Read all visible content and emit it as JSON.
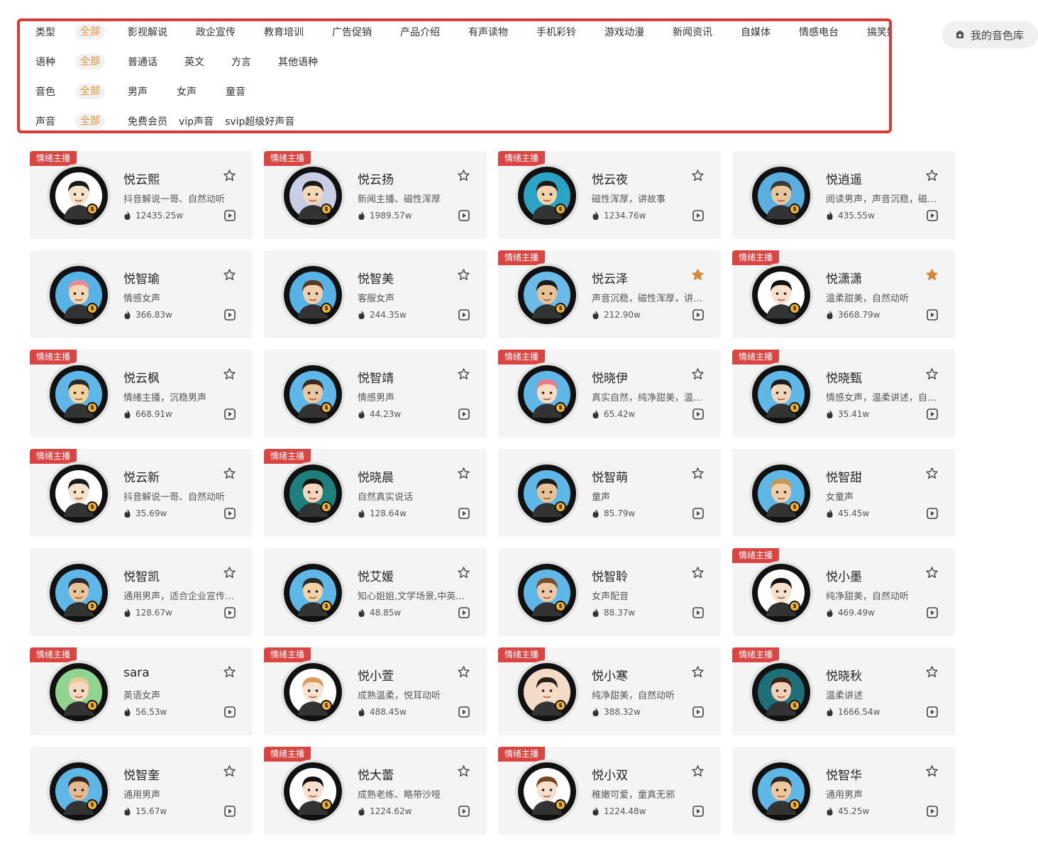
{
  "filters": {
    "type": {
      "label": "类型",
      "all": "全部",
      "options": [
        "影视解说",
        "政企宣传",
        "教育培训",
        "广告促销",
        "产品介绍",
        "有声读物",
        "手机彩铃",
        "游戏动漫",
        "新闻资讯",
        "自媒体",
        "情感电台",
        "搞笑娱乐"
      ]
    },
    "lang": {
      "label": "语种",
      "all": "全部",
      "options": [
        "普通话",
        "英文",
        "方言",
        "其他语种"
      ]
    },
    "timbre": {
      "label": "音色",
      "all": "全部",
      "options": [
        "男声",
        "女声",
        "童音"
      ]
    },
    "voice": {
      "label": "声音",
      "all": "全部",
      "options": [
        "免费会员",
        "vip声音",
        "svip超级好声音"
      ]
    }
  },
  "library_button": "我的音色库",
  "badge_text": "情绪主播",
  "coin_text": "$",
  "colors": {
    "accent": "#e0953b",
    "badge": "#d94542",
    "frame": "#d93a35",
    "star_active": "#d4883a"
  },
  "cards": [
    {
      "name": "悦云熙",
      "desc": "抖音解说一哥、自然动听",
      "plays": "12435.25w",
      "badge": true,
      "fav": false,
      "skin": "#f6e2c8",
      "hair": "#1a1a1a",
      "bg": "#ffffff"
    },
    {
      "name": "悦云扬",
      "desc": "新闻主播、磁性浑厚",
      "plays": "1989.57w",
      "badge": true,
      "fav": false,
      "skin": "#f3d8b8",
      "hair": "#1a1a1a",
      "bg": "#c9cde6"
    },
    {
      "name": "悦云夜",
      "desc": "磁性浑厚，讲故事",
      "plays": "1234.76w",
      "badge": true,
      "fav": false,
      "skin": "#f1d2a8",
      "hair": "#1a1a1a",
      "bg": "#2ba3c4"
    },
    {
      "name": "悦逍遥",
      "desc": "阅读男声，声音沉稳，磁性浑厚",
      "plays": "435.55w",
      "badge": false,
      "fav": false,
      "skin": "#e8c69c",
      "hair": "#3a3a3a",
      "bg": "#5aaee0"
    },
    {
      "name": "悦智瑜",
      "desc": "情感女声",
      "plays": "366.83w",
      "badge": false,
      "fav": false,
      "skin": "#f1d7b6",
      "hair": "#e98a9b",
      "bg": "#57b3e6"
    },
    {
      "name": "悦智美",
      "desc": "客服女声",
      "plays": "244.35w",
      "badge": false,
      "fav": false,
      "skin": "#f0cfae",
      "hair": "#5b3a24",
      "bg": "#57b3e6"
    },
    {
      "name": "悦云泽",
      "desc": "声音沉稳，磁性浑厚，讲故事",
      "plays": "212.90w",
      "badge": true,
      "fav": true,
      "skin": "#e8c197",
      "hair": "#1a1a1a",
      "bg": "#6bbbe8"
    },
    {
      "name": "悦潇潇",
      "desc": "温柔甜美，自然动听",
      "plays": "3668.79w",
      "badge": true,
      "fav": true,
      "skin": "#f7e0cd",
      "hair": "#111111",
      "bg": "#ffffff"
    },
    {
      "name": "悦云枫",
      "desc": "情绪主播，沉稳男声",
      "plays": "668.91w",
      "badge": true,
      "fav": false,
      "skin": "#f2d3a0",
      "hair": "#2a2a2a",
      "bg": "#5fb7e8"
    },
    {
      "name": "悦智靖",
      "desc": "情感男声",
      "plays": "44.23w",
      "badge": false,
      "fav": false,
      "skin": "#e9c7a0",
      "hair": "#3a2a1e",
      "bg": "#5fb7e8"
    },
    {
      "name": "悦晓伊",
      "desc": "真实自然，纯净甜美，温柔讲述",
      "plays": "65.42w",
      "badge": true,
      "fav": false,
      "skin": "#f6dcc3",
      "hair": "#f07a8c",
      "bg": "#5fb7e8"
    },
    {
      "name": "悦晓甄",
      "desc": "情感女声，温柔讲述，自然动听",
      "plays": "35.41w",
      "badge": true,
      "fav": false,
      "skin": "#f2d6bb",
      "hair": "#1c1c1c",
      "bg": "#5fb7e8"
    },
    {
      "name": "悦云新",
      "desc": "抖音解说一哥、自然动听",
      "plays": "35.69w",
      "badge": true,
      "fav": false,
      "skin": "#f6e2c8",
      "hair": "#1a1a1a",
      "bg": "#ffffff"
    },
    {
      "name": "悦晓晨",
      "desc": "自然真实说话",
      "plays": "128.64w",
      "badge": true,
      "fav": false,
      "skin": "#f3d6bd",
      "hair": "#111111",
      "bg": "#1f7f7d"
    },
    {
      "name": "悦智萌",
      "desc": "童声",
      "plays": "85.79w",
      "badge": false,
      "fav": false,
      "skin": "#e8c197",
      "hair": "#1a1a1a",
      "bg": "#5fb7e8"
    },
    {
      "name": "悦智甜",
      "desc": "女童声",
      "plays": "45.45w",
      "badge": false,
      "fav": false,
      "skin": "#efcfa9",
      "hair": "#c9964a",
      "bg": "#5fb7e8"
    },
    {
      "name": "悦智凯",
      "desc": "通用男声，适合企业宣传片配音",
      "plays": "128.67w",
      "badge": false,
      "fav": false,
      "skin": "#e9c39a",
      "hair": "#2a2a2a",
      "bg": "#5fb7e8"
    },
    {
      "name": "悦艾媛",
      "desc": "知心姐姐,文学场景,中英文混合",
      "plays": "48.85w",
      "badge": false,
      "fav": false,
      "skin": "#f2d3a8",
      "hair": "#2a2a2a",
      "bg": "#5fb7e8"
    },
    {
      "name": "悦智聆",
      "desc": "女声配音",
      "plays": "88.37w",
      "badge": false,
      "fav": false,
      "skin": "#ecc9a4",
      "hair": "#7a4a2a",
      "bg": "#5fb7e8"
    },
    {
      "name": "悦小墨",
      "desc": "纯净甜美，自然动听",
      "plays": "469.49w",
      "badge": true,
      "fav": false,
      "skin": "#f6dfcc",
      "hair": "#111111",
      "bg": "#ffffff"
    },
    {
      "name": "sara",
      "desc": "英语女声",
      "plays": "56.53w",
      "badge": true,
      "fav": false,
      "skin": "#f6d7c0",
      "hair": "#e9c995",
      "bg": "#8fd58f"
    },
    {
      "name": "悦小萱",
      "desc": "成熟温柔，悦耳动听",
      "plays": "488.45w",
      "badge": true,
      "fav": false,
      "skin": "#f7e2d0",
      "hair": "#d99a5a",
      "bg": "#ffffff"
    },
    {
      "name": "悦小寒",
      "desc": "纯净甜美，自然动听",
      "plays": "388.32w",
      "badge": true,
      "fav": false,
      "skin": "#f5dcc8",
      "hair": "#2a1e1a",
      "bg": "#f2dcc8"
    },
    {
      "name": "悦晓秋",
      "desc": "温柔讲述",
      "plays": "1666.54w",
      "badge": true,
      "fav": false,
      "skin": "#f0d0b6",
      "hair": "#3a2418",
      "bg": "#1f6f7a"
    },
    {
      "name": "悦智奎",
      "desc": "通用男声",
      "plays": "15.67w",
      "badge": false,
      "fav": false,
      "skin": "#e3b994",
      "hair": "#3a2418",
      "bg": "#5fb7e8"
    },
    {
      "name": "悦大蕾",
      "desc": "成熟老练、略带沙哑",
      "plays": "1224.62w",
      "badge": true,
      "fav": false,
      "skin": "#f6dfcc",
      "hair": "#111111",
      "bg": "#ffffff"
    },
    {
      "name": "悦小双",
      "desc": "稚嫩可爱，童真无邪",
      "plays": "1224.48w",
      "badge": true,
      "fav": false,
      "skin": "#f6dfcc",
      "hair": "#7a4626",
      "bg": "#ffffff"
    },
    {
      "name": "悦智华",
      "desc": "通用男声",
      "plays": "45.25w",
      "badge": false,
      "fav": false,
      "skin": "#eec79d",
      "hair": "#2a2a2a",
      "bg": "#5fb7e8"
    }
  ]
}
